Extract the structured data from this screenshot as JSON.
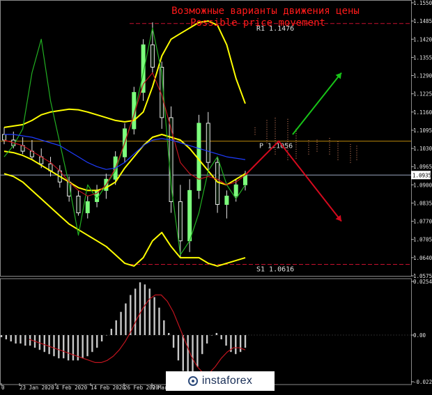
{
  "chart_data": [
    {
      "type": "candlestick",
      "title": "Возможные варианты движения цены",
      "subtitle": "Possible price movement",
      "ylim": [
        1.0575,
        1.155
      ],
      "y_ticks": [
        "1.1550",
        "1.1485",
        "1.1420",
        "1.1355",
        "1.1290",
        "1.1225",
        "1.1160",
        "1.1095",
        "1.1030",
        "1.0965",
        "1.0900",
        "1.0835",
        "1.0770",
        "1.0705",
        "1.0640",
        "1.0575"
      ],
      "current_price": "1.0935",
      "levels": [
        {
          "name": "R1",
          "label": "R1 1.1476",
          "value": 1.1476,
          "color": "#c8102e",
          "style": "dashed"
        },
        {
          "name": "P",
          "label": "P 1.1056",
          "value": 1.1056,
          "color": "#b8860b",
          "style": "solid"
        },
        {
          "name": "S1",
          "label": "S1 1.0616",
          "value": 1.0616,
          "color": "#c8102e",
          "style": "dashed"
        }
      ],
      "x_tick_labels": [
        "0",
        "23 Jan 2020",
        "4 Feb 2020",
        "14 Feb 2020",
        "26 Feb 2020",
        "9 Mar"
      ],
      "series": [
        {
          "name": "Bollinger upper",
          "color": "#ffff00",
          "values": [
            1.1105,
            1.111,
            1.1115,
            1.113,
            1.115,
            1.116,
            1.1165,
            1.117,
            1.1168,
            1.116,
            1.115,
            1.114,
            1.113,
            1.1125,
            1.113,
            1.116,
            1.125,
            1.136,
            1.142,
            1.144,
            1.146,
            1.148,
            1.1485,
            1.147,
            1.14,
            1.128,
            1.119
          ]
        },
        {
          "name": "Bollinger middle",
          "color": "#ffff00",
          "values": [
            1.102,
            1.1015,
            1.1005,
            1.099,
            1.097,
            1.095,
            1.093,
            1.091,
            1.089,
            1.088,
            1.088,
            1.089,
            1.091,
            1.096,
            1.1,
            1.104,
            1.107,
            1.108,
            1.107,
            1.106,
            1.103,
            1.099,
            1.095,
            1.091,
            1.09,
            1.092,
            1.094
          ]
        },
        {
          "name": "Bollinger lower",
          "color": "#ffff00",
          "values": [
            1.094,
            1.093,
            1.091,
            1.088,
            1.085,
            1.082,
            1.079,
            1.076,
            1.074,
            1.072,
            1.07,
            1.068,
            1.065,
            1.062,
            1.061,
            1.064,
            1.07,
            1.073,
            1.068,
            1.064,
            1.064,
            1.064,
            1.062,
            1.061,
            1.062,
            1.063,
            1.064
          ]
        },
        {
          "name": "Envelope green",
          "color": "#22b022",
          "values": [
            1.1,
            1.104,
            1.11,
            1.13,
            1.142,
            1.12,
            1.105,
            1.09,
            1.072,
            1.09,
            1.085,
            1.09,
            1.095,
            1.105,
            1.115,
            1.13,
            1.146,
            1.13,
            1.09,
            1.065,
            1.07,
            1.08,
            1.095,
            1.1,
            1.09,
            1.085,
            1.09
          ]
        },
        {
          "name": "Moving average red",
          "color": "#c0141e",
          "values": [
            1.106,
            1.105,
            1.104,
            1.102,
            1.1,
            1.098,
            1.095,
            1.091,
            1.088,
            1.086,
            1.087,
            1.09,
            1.096,
            1.105,
            1.115,
            1.126,
            1.13,
            1.122,
            1.11,
            1.098,
            1.094,
            1.092,
            1.093,
            1.092,
            1.09,
            1.091,
            1.0935
          ]
        },
        {
          "name": "Moving average blue",
          "color": "#1e3cff",
          "values": [
            1.108,
            1.108,
            1.1075,
            1.107,
            1.106,
            1.105,
            1.104,
            1.102,
            1.1,
            1.098,
            1.0965,
            1.0955,
            1.096,
            1.098,
            1.101,
            1.104,
            1.106,
            1.1065,
            1.106,
            1.105,
            1.104,
            1.103,
            1.102,
            1.101,
            1.1,
            1.0995,
            1.099
          ]
        }
      ],
      "candles": [
        {
          "o": 1.108,
          "h": 1.1105,
          "l": 1.1045,
          "c": 1.106
        },
        {
          "o": 1.106,
          "h": 1.109,
          "l": 1.103,
          "c": 1.104
        },
        {
          "o": 1.104,
          "h": 1.107,
          "l": 1.101,
          "c": 1.102
        },
        {
          "o": 1.102,
          "h": 1.106,
          "l": 1.099,
          "c": 1.1
        },
        {
          "o": 1.1,
          "h": 1.103,
          "l": 1.096,
          "c": 1.0975
        },
        {
          "o": 1.0975,
          "h": 1.1,
          "l": 1.093,
          "c": 1.095
        },
        {
          "o": 1.095,
          "h": 1.097,
          "l": 1.089,
          "c": 1.091
        },
        {
          "o": 1.091,
          "h": 1.093,
          "l": 1.084,
          "c": 1.086
        },
        {
          "o": 1.086,
          "h": 1.088,
          "l": 1.079,
          "c": 1.08
        },
        {
          "o": 1.08,
          "h": 1.086,
          "l": 1.078,
          "c": 1.084
        },
        {
          "o": 1.084,
          "h": 1.09,
          "l": 1.082,
          "c": 1.088
        },
        {
          "o": 1.088,
          "h": 1.094,
          "l": 1.085,
          "c": 1.092
        },
        {
          "o": 1.092,
          "h": 1.102,
          "l": 1.09,
          "c": 1.1
        },
        {
          "o": 1.1,
          "h": 1.112,
          "l": 1.098,
          "c": 1.11
        },
        {
          "o": 1.11,
          "h": 1.125,
          "l": 1.108,
          "c": 1.123
        },
        {
          "o": 1.123,
          "h": 1.142,
          "l": 1.12,
          "c": 1.14
        },
        {
          "o": 1.14,
          "h": 1.148,
          "l": 1.13,
          "c": 1.132
        },
        {
          "o": 1.132,
          "h": 1.134,
          "l": 1.11,
          "c": 1.114
        },
        {
          "o": 1.114,
          "h": 1.118,
          "l": 1.08,
          "c": 1.084
        },
        {
          "o": 1.084,
          "h": 1.09,
          "l": 1.064,
          "c": 1.07
        },
        {
          "o": 1.07,
          "h": 1.092,
          "l": 1.066,
          "c": 1.088
        },
        {
          "o": 1.088,
          "h": 1.115,
          "l": 1.085,
          "c": 1.112
        },
        {
          "o": 1.112,
          "h": 1.116,
          "l": 1.095,
          "c": 1.098
        },
        {
          "o": 1.098,
          "h": 1.1,
          "l": 1.08,
          "c": 1.083
        },
        {
          "o": 1.083,
          "h": 1.088,
          "l": 1.078,
          "c": 1.086
        },
        {
          "o": 1.086,
          "h": 1.092,
          "l": 1.084,
          "c": 1.09
        },
        {
          "o": 1.09,
          "h": 1.095,
          "l": 1.088,
          "c": 1.0935
        }
      ],
      "forecast": {
        "up_path": [
          1.0935,
          1.1056,
          1.13
        ],
        "down_path": [
          1.0935,
          1.1056,
          1.077
        ],
        "up_color": "#18c418",
        "down_color": "#d40a1e"
      }
    },
    {
      "type": "histogram",
      "ylim": [
        -0.02212,
        0.02542
      ],
      "y_ticks": [
        "0.02542",
        "0.00",
        "-0.02212"
      ],
      "bars_color": "#c8c8c8",
      "signal_color": "#c0141e",
      "values": [
        -0.001,
        -0.002,
        -0.003,
        -0.004,
        -0.004,
        -0.005,
        -0.005,
        -0.006,
        -0.007,
        -0.008,
        -0.009,
        -0.01,
        -0.011,
        -0.011,
        -0.012,
        -0.012,
        -0.012,
        -0.011,
        -0.01,
        -0.008,
        -0.006,
        -0.003,
        0.0,
        0.003,
        0.007,
        0.011,
        0.015,
        0.019,
        0.022,
        0.025,
        0.024,
        0.022,
        0.018,
        0.013,
        0.007,
        0.001,
        -0.006,
        -0.012,
        -0.017,
        -0.02,
        -0.019,
        -0.015,
        -0.009,
        -0.004,
        0.0,
        0.001,
        -0.002,
        -0.005,
        -0.008,
        -0.009,
        -0.008,
        -0.006
      ],
      "signal": [
        -0.002,
        -0.003,
        -0.004,
        -0.005,
        -0.006,
        -0.007,
        -0.008,
        -0.009,
        -0.01,
        -0.011,
        -0.012,
        -0.013,
        -0.013,
        -0.012,
        -0.01,
        -0.007,
        -0.003,
        0.002,
        0.008,
        0.013,
        0.017,
        0.019,
        0.019,
        0.016,
        0.011,
        0.004,
        -0.003,
        -0.01,
        -0.015,
        -0.018,
        -0.018,
        -0.015,
        -0.011,
        -0.008,
        -0.006,
        -0.006,
        -0.007
      ]
    }
  ],
  "footer": {
    "brand": "instaforex"
  }
}
